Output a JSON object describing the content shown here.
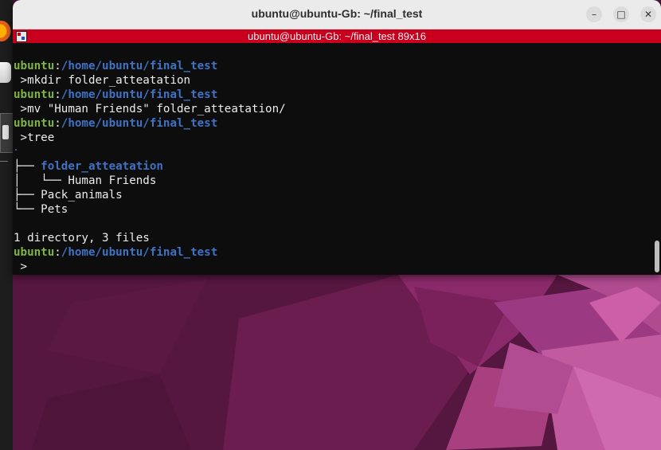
{
  "window": {
    "title": "ubuntu@ubuntu-Gb: ~/final_test",
    "tab_title": "ubuntu@ubuntu-Gb: ~/final_test 89x16",
    "minimize_icon": "minimize-icon",
    "maximize_icon": "maximize-icon",
    "close_icon": "close-icon"
  },
  "terminal": {
    "prompt_user": "ubuntu",
    "prompt_sep": ":",
    "prompt_path": "/home/ubuntu/final_test",
    "commands": [
      " >mkdir folder_atteatation",
      " >mv \"Human Friends\" folder_atteatation/",
      " >tree",
      " >"
    ],
    "tree_root": ".",
    "tree": [
      {
        "prefix": "├── ",
        "name": "folder_atteatation",
        "is_dir": true
      },
      {
        "prefix": "│   └── ",
        "name": "Human Friends",
        "is_dir": false
      },
      {
        "prefix": "├── ",
        "name": "Pack_animals",
        "is_dir": false
      },
      {
        "prefix": "└── ",
        "name": "Pets",
        "is_dir": false
      }
    ],
    "summary": "1 directory, 3 files"
  },
  "colors": {
    "tab_bar": "#c8001e",
    "prompt_user": "#7eb43f",
    "prompt_path": "#3f72c4",
    "terminal_bg": "#0d0d0d"
  }
}
